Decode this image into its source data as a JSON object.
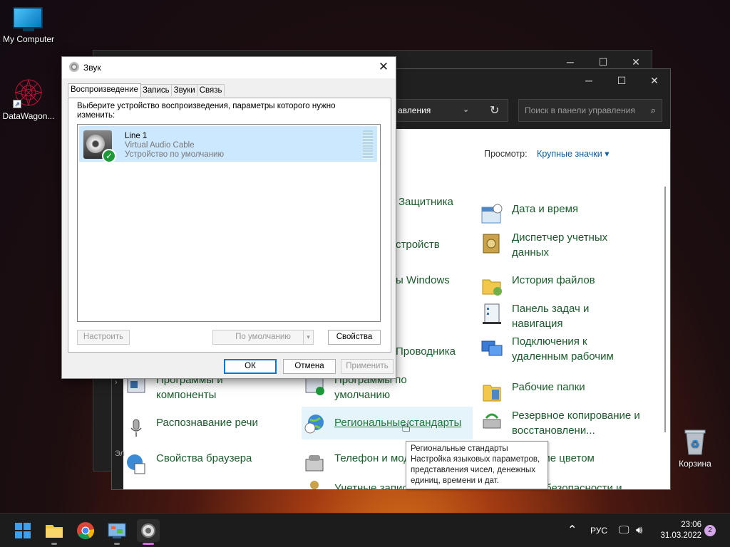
{
  "desktop": {
    "icons": [
      {
        "label": "My Computer"
      },
      {
        "label": "DataWagon..."
      },
      {
        "label": "Корзина"
      }
    ]
  },
  "control_panel": {
    "address_text": "авления",
    "search_placeholder": "Поиск в панели управления",
    "view_label": "Просмотр:",
    "view_value": "Крупные значки",
    "left_strip_text": "Эл",
    "items": [
      {
        "label": "Защитника",
        "icon": "defender-icon"
      },
      {
        "label": "стройств",
        "icon": "devices-icon"
      },
      {
        "label": "ы Windows",
        "icon": "windows-icon"
      },
      {
        "label": "Проводника",
        "icon": "explorer-icon"
      },
      {
        "label": "Дата и время",
        "icon": "calendar-icon"
      },
      {
        "label": "Диспетчер учетных данных",
        "icon": "credential-icon"
      },
      {
        "label": "История файлов",
        "icon": "file-history-icon"
      },
      {
        "label": "Панель задач и навигация",
        "icon": "taskbar-icon"
      },
      {
        "label": "Подключения к удаленным рабочим",
        "icon": "remote-icon"
      },
      {
        "label": "Рабочие папки",
        "icon": "work-folders-icon"
      },
      {
        "label": "Резервное копирование и восстановлени...",
        "icon": "backup-icon"
      },
      {
        "label": "ление цветом",
        "icon": "color-icon"
      },
      {
        "label": "Центр безопасности и",
        "icon": "security-icon"
      },
      {
        "label": "Программы и компоненты",
        "icon": "programs-icon"
      },
      {
        "label": "Программы по умолчанию",
        "icon": "default-programs-icon"
      },
      {
        "label": "Распознавание речи",
        "icon": "microphone-icon"
      },
      {
        "label": "Региональные стандарты",
        "icon": "region-icon"
      },
      {
        "label": "Свойства браузера",
        "icon": "browser-icon"
      },
      {
        "label": "Телефон и мод",
        "icon": "phone-icon"
      },
      {
        "label": "Учетные записи",
        "icon": "accounts-icon"
      }
    ],
    "tooltip": {
      "title": "Региональные стандарты",
      "body": "Настройка языковых параметров, представления чисел, денежных единиц, времени и дат."
    }
  },
  "sound_dialog": {
    "title": "Звук",
    "tabs": [
      "Воспроизведение",
      "Запись",
      "Звуки",
      "Связь"
    ],
    "instruction": "Выберите устройство воспроизведения, параметры которого нужно изменить:",
    "device": {
      "name": "Line 1",
      "description": "Virtual Audio Cable",
      "status": "Устройство по умолчанию"
    },
    "buttons": {
      "configure": "Настроить",
      "set_default": "По умолчанию",
      "properties": "Свойства",
      "ok": "ОК",
      "cancel": "Отмена",
      "apply": "Применить"
    }
  },
  "taskbar": {
    "language": "РУС",
    "time": "23:06",
    "date": "31.03.2022",
    "notifications": "2"
  },
  "colors": {
    "accent": "#0078d4",
    "link_green": "#1a5b2b",
    "selection": "#cce8ff"
  }
}
